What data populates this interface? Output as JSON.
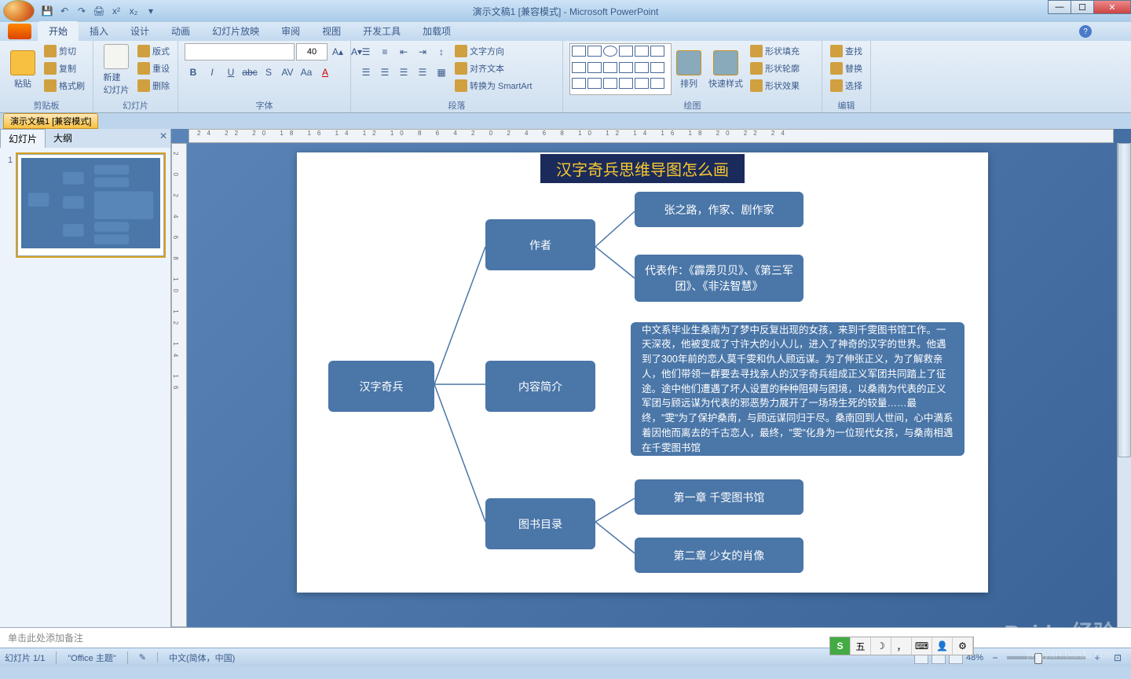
{
  "window": {
    "title": "演示文稿1 [兼容模式] - Microsoft PowerPoint"
  },
  "qat": {
    "save": "💾",
    "undo": "↶",
    "redo": "↷",
    "print": "🖨",
    "x1": "x²",
    "x2": "x₂"
  },
  "ribbonTabs": [
    "开始",
    "插入",
    "设计",
    "动画",
    "幻灯片放映",
    "审阅",
    "视图",
    "开发工具",
    "加载项"
  ],
  "ribbon": {
    "clipboard": {
      "label": "剪贴板",
      "paste": "粘贴",
      "cut": "剪切",
      "copy": "复制",
      "format": "格式刷"
    },
    "slides": {
      "label": "幻灯片",
      "new": "新建\n幻灯片",
      "layout": "版式",
      "reset": "重设",
      "delete": "删除"
    },
    "font": {
      "label": "字体",
      "size": "40",
      "bold": "B",
      "italic": "I",
      "underline": "U",
      "strike": "abc",
      "shadow": "S",
      "spacing": "AV",
      "case": "Aa",
      "clear": "A",
      "grow": "A▴",
      "shrink": "A▾"
    },
    "para": {
      "label": "段落",
      "dir": "文字方向",
      "align": "对齐文本",
      "smart": "转换为 SmartArt"
    },
    "draw": {
      "label": "绘图",
      "arrange": "排列",
      "quick": "快速样式",
      "fill": "形状填充",
      "outline": "形状轮廓",
      "effect": "形状效果"
    },
    "edit": {
      "label": "编辑",
      "find": "查找",
      "replace": "替换",
      "select": "选择"
    }
  },
  "docTab": "演示文稿1 [兼容模式]",
  "panelTabs": {
    "slides": "幻灯片",
    "outline": "大纲"
  },
  "mindmap": {
    "title": "汉字奇兵思维导图怎么画",
    "root": "汉字奇兵",
    "b1": "作者",
    "b2": "内容简介",
    "b3": "图书目录",
    "l1": "张之路，作家、剧作家",
    "l2": "代表作：《霹雳贝贝》、《第三军团》、《非法智慧》",
    "l3": "中文系毕业生桑南为了梦中反复出现的女孩，来到千雯图书馆工作。一天深夜，他被变成了寸许大的小人儿，进入了神奇的汉字的世界。他遇到了300年前的恋人莫千雯和仇人顾远谋。为了伸张正义，为了解救亲人，他们带领一群要去寻找亲人的汉字奇兵组成正义军团共同踏上了征途。途中他们遭遇了坏人设置的种种阻碍与困境，以桑南为代表的正义军团与顾远谋为代表的邪恶势力展开了一场场生死的较量……最终，\"雯\"为了保护桑南，与顾远谋同归于尽。桑南回到人世间，心中満系着因他而离去的千古恋人，最终，\"雯\"化身为一位现代女孩，与桑南相遇在千雯图书馆",
    "l4": "第一章 千雯图书馆",
    "l5": "第二章 少女的肖像"
  },
  "notes": "单击此处添加备注",
  "status": {
    "slide": "幻灯片 1/1",
    "theme": "\"Office 主题\"",
    "lang": "中文(简体，中国)",
    "zoom": "48%",
    "ime": "五"
  },
  "watermark": {
    "main": "Baidu 经验",
    "sub": "jingyan.baidu.com"
  }
}
